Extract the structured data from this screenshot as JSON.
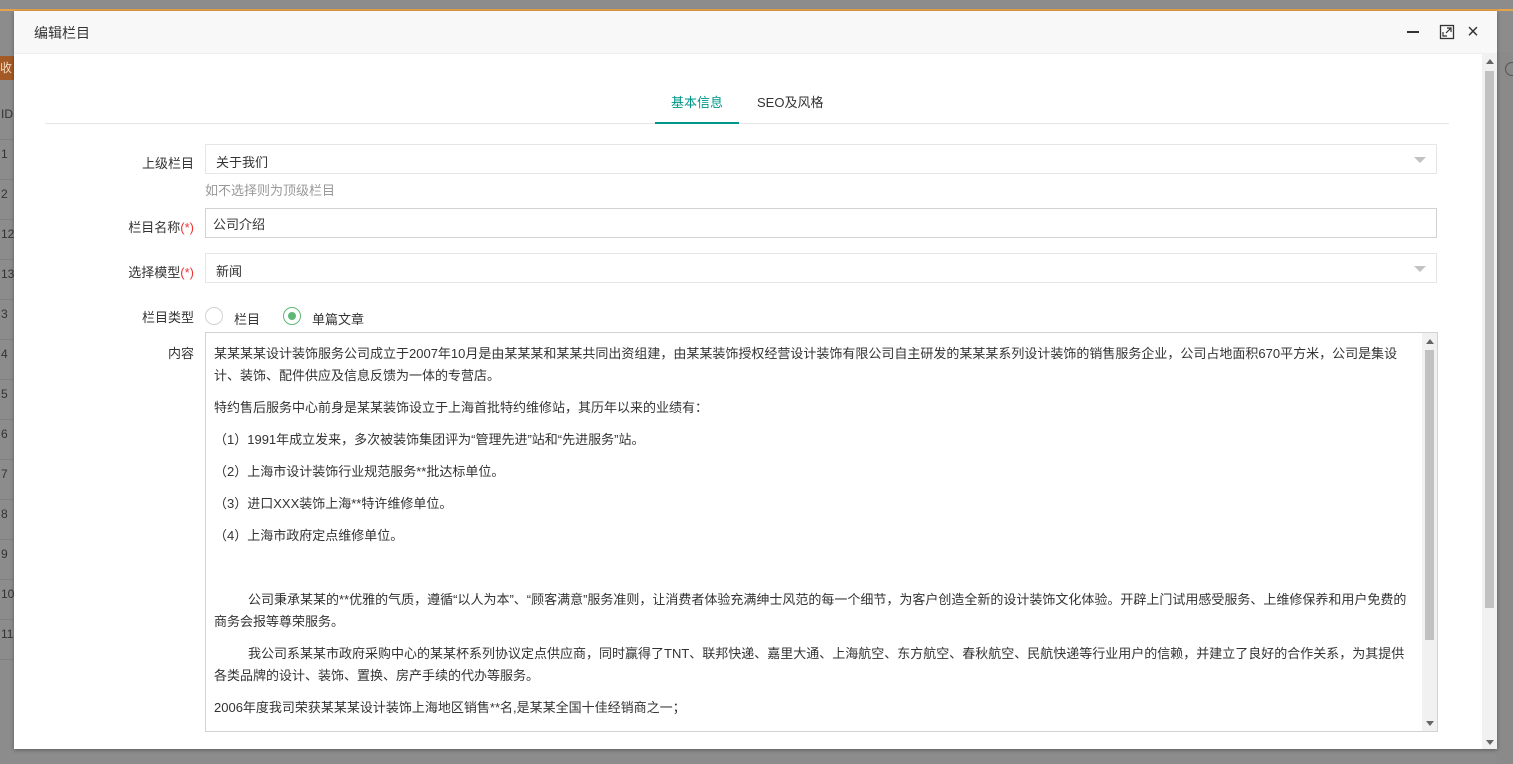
{
  "background": {
    "tag_text": "收",
    "row_ids": [
      "ID",
      "1",
      "2",
      "12",
      "13",
      "3",
      "4",
      "5",
      "6",
      "7",
      "8",
      "9",
      "10",
      "11"
    ]
  },
  "modal": {
    "title": "编辑栏目",
    "buttons": {
      "minimize": "minimize-icon",
      "maximize": "maximize-icon",
      "close": "×"
    }
  },
  "tabs": [
    {
      "label": "基本信息",
      "active": true
    },
    {
      "label": "SEO及风格",
      "active": false
    }
  ],
  "form": {
    "parent": {
      "label": "上级栏目",
      "value": "关于我们",
      "hint": "如不选择则为顶级栏目"
    },
    "name": {
      "label": "栏目名称",
      "required_mark": "(*)",
      "value": "公司介绍"
    },
    "model": {
      "label": "选择模型",
      "required_mark": "(*)",
      "value": "新闻"
    },
    "type": {
      "label": "栏目类型",
      "options": [
        {
          "label": "栏目",
          "checked": false
        },
        {
          "label": "单篇文章",
          "checked": true
        }
      ]
    },
    "content": {
      "label": "内容",
      "paragraphs": [
        "某某某某设计装饰服务公司成立于2007年10月是由某某某和某某共同出资组建，由某某装饰授权经营设计装饰有限公司自主研发的某某某系列设计装饰的销售服务企业，公司占地面积670平方米，公司是集设计、装饰、配件供应及信息反馈为一体的专营店。",
        "特约售后服务中心前身是某某装饰设立于上海首批特约维修站，其历年以来的业绩有：",
        "（1）1991年成立发来，多次被装饰集团评为“管理先进”站和“先进服务”站。",
        "（2）上海市设计装饰行业规范服务**批达标单位。",
        "（3）进口XXX装饰上海**特许维修单位。",
        "（4）上海市政府定点维修单位。",
        "公司秉承某某的**优雅的气质，遵循“以人为本”、“顾客满意”服务准则，让消费者体验充满绅士风范的每一个细节，为客户创造全新的设计装饰文化体验。开辟上门试用感受服务、上维修保养和用户免费的商务会报等尊荣服务。",
        "我公司系某某市政府采购中心的某某杯系列协议定点供应商，同时赢得了TNT、联邦快递、嘉里大通、上海航空、东方航空、春秋航空、民航快递等行业用户的信赖，并建立了良好的合作关系，为其提供各类品牌的设计、装饰、置换、房产手续的代办等服务。",
        "2006年度我司荣获某某某设计装饰上海地区销售**名,是某某全国十佳经销商之一；"
      ]
    }
  },
  "colors": {
    "accent": "#009688",
    "radio_checked": "#5fb878",
    "required": "#e33333",
    "top_bar": "#e8a24b"
  }
}
